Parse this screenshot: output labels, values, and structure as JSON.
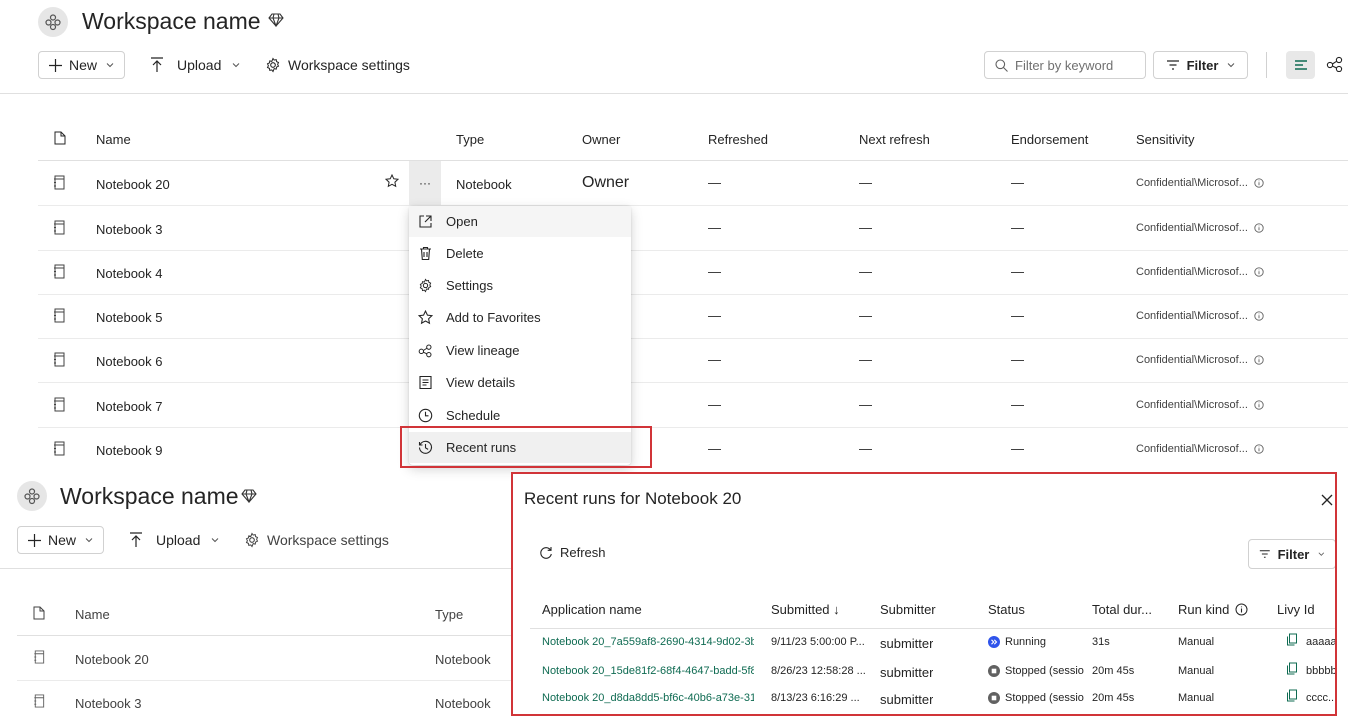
{
  "top": {
    "title": "Workspace name",
    "toolbar": {
      "new_label": "New",
      "upload_label": "Upload",
      "settings_label": "Workspace settings"
    },
    "filter_placeholder": "Filter by keyword",
    "filter_label": "Filter",
    "columns": [
      "Name",
      "Type",
      "Owner",
      "Refreshed",
      "Next refresh",
      "Endorsement",
      "Sensitivity"
    ],
    "rows": [
      {
        "name": "Notebook 20",
        "type": "Notebook",
        "owner": "Owner",
        "refreshed": "—",
        "next": "—",
        "endorse": "—",
        "sensitivity": "Confidential\\Microsof..."
      },
      {
        "name": "Notebook 3",
        "refreshed": "—",
        "next": "—",
        "endorse": "—",
        "sensitivity": "Confidential\\Microsof..."
      },
      {
        "name": "Notebook 4",
        "refreshed": "—",
        "next": "—",
        "endorse": "—",
        "sensitivity": "Confidential\\Microsof..."
      },
      {
        "name": "Notebook 5",
        "refreshed": "—",
        "next": "—",
        "endorse": "—",
        "sensitivity": "Confidential\\Microsof..."
      },
      {
        "name": "Notebook 6",
        "refreshed": "—",
        "next": "—",
        "endorse": "—",
        "sensitivity": "Confidential\\Microsof..."
      },
      {
        "name": "Notebook 7",
        "refreshed": "—",
        "next": "—",
        "endorse": "—",
        "sensitivity": "Confidential\\Microsof..."
      },
      {
        "name": "Notebook 9",
        "refreshed": "—",
        "next": "—",
        "endorse": "—",
        "sensitivity": "Confidential\\Microsof..."
      }
    ],
    "more_label": "···"
  },
  "menu": {
    "items": [
      {
        "label": "Open",
        "icon": "open-external-icon"
      },
      {
        "label": "Delete",
        "icon": "trash-icon"
      },
      {
        "label": "Settings",
        "icon": "gear-icon"
      },
      {
        "label": "Add to Favorites",
        "icon": "star-icon"
      },
      {
        "label": "View lineage",
        "icon": "lineage-icon"
      },
      {
        "label": "View details",
        "icon": "details-icon"
      },
      {
        "label": "Schedule",
        "icon": "clock-icon"
      },
      {
        "label": "Recent runs",
        "icon": "history-icon"
      }
    ]
  },
  "bottom": {
    "title": "Workspace name",
    "toolbar": {
      "new_label": "New",
      "upload_label": "Upload",
      "settings_label": "Workspace settings"
    },
    "columns": [
      "Name",
      "Type"
    ],
    "rows": [
      {
        "name": "Notebook 20",
        "type": "Notebook"
      },
      {
        "name": "Notebook 3",
        "type": "Notebook"
      }
    ]
  },
  "panel": {
    "title": "Recent runs for Notebook 20",
    "refresh_label": "Refresh",
    "filter_label": "Filter",
    "columns": [
      "Application name",
      "Submitted ↓",
      "Submitter",
      "Status",
      "Total dur...",
      "Run kind",
      "Livy Id"
    ],
    "runs": [
      {
        "app": "Notebook 20_7a559af8-2690-4314-9d02-3b",
        "submitted": "9/11/23 5:00:00 P...",
        "submitter": "submitter",
        "status": "Running",
        "duration": "31s",
        "kind": "Manual",
        "livy": "aaaaa"
      },
      {
        "app": "Notebook 20_15de81f2-68f4-4647-badd-5f8",
        "submitted": "8/26/23 12:58:28 ...",
        "submitter": "submitter",
        "status": "Stopped (sessio",
        "duration": "20m 45s",
        "kind": "Manual",
        "livy": "bbbbb"
      },
      {
        "app": "Notebook 20_d8da8dd5-bf6c-40b6-a73e-31",
        "submitted": "8/13/23 6:16:29 ...",
        "submitter": "submitter",
        "status": "Stopped (sessio",
        "duration": "20m 45s",
        "kind": "Manual",
        "livy": "cccc..."
      }
    ]
  },
  "colors": {
    "accent_green": "#0f6b52",
    "highlight_red": "#d13438",
    "running_blue": "#2f54eb",
    "stopped_gray": "#616161"
  }
}
